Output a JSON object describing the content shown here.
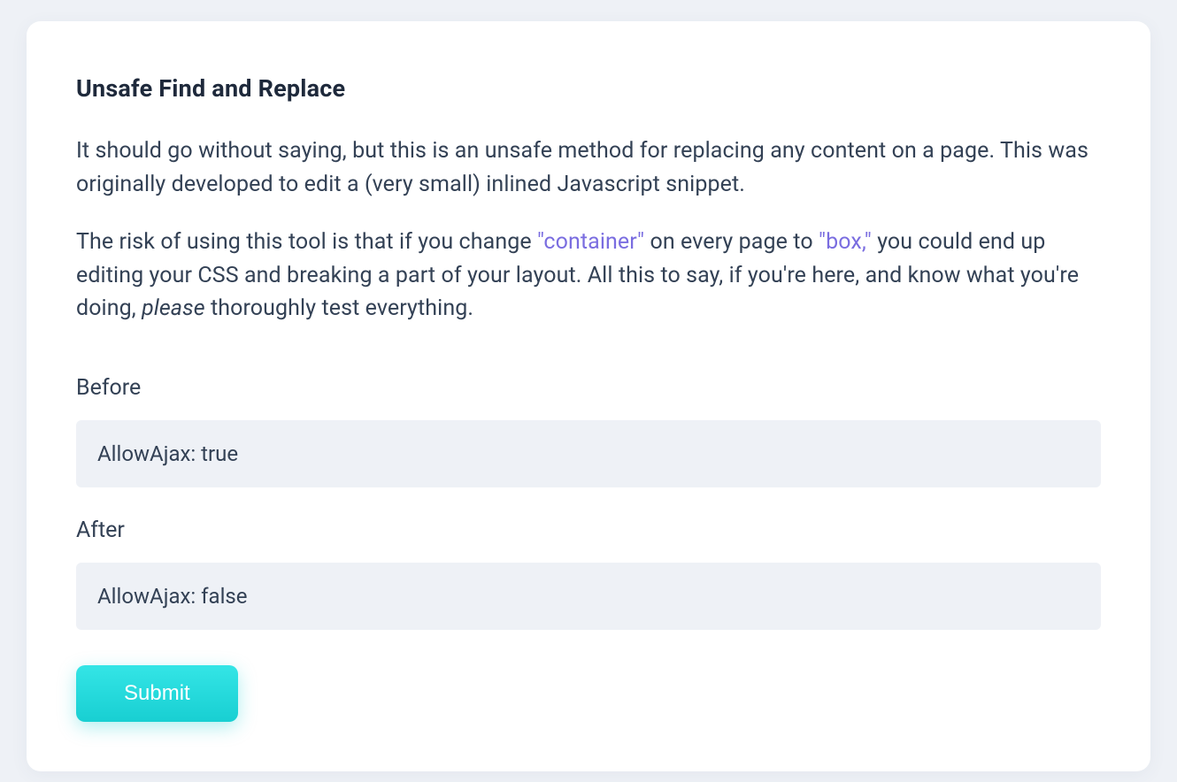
{
  "card": {
    "title": "Unsafe Find and Replace",
    "para1": "It should go without saying, but this is an unsafe method for replacing any content on a page. This was originally developed to edit a (very small) inlined Javascript snippet.",
    "para2_pre": "The risk of using this tool is that if you change ",
    "para2_hl1": "\"container\"",
    "para2_mid1": " on every page to ",
    "para2_hl2": "\"box,\"",
    "para2_mid2": " you could end up editing your CSS and breaking a part of your layout. All this to say, if you're here, and know what you're doing, ",
    "para2_em": "please",
    "para2_post": " thoroughly test everything."
  },
  "form": {
    "before_label": "Before",
    "before_placeholder": "AllowAjax: true",
    "before_value": "",
    "after_label": "After",
    "after_placeholder": "AllowAjax: false",
    "after_value": "",
    "submit_label": "Submit"
  }
}
